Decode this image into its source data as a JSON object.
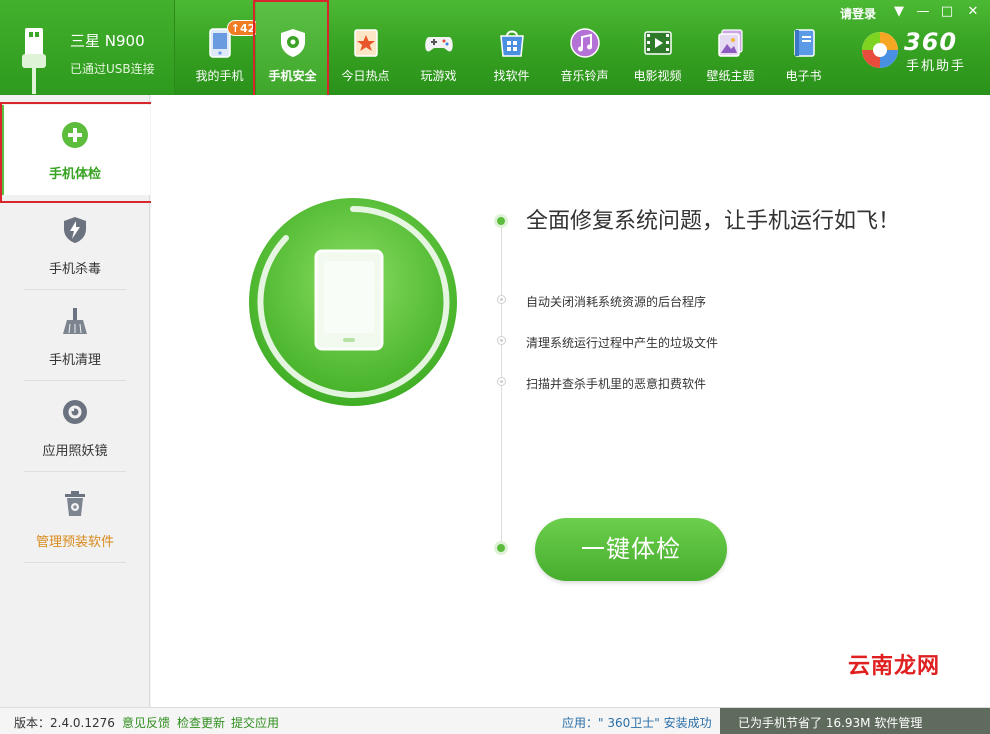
{
  "device": {
    "name": "三星 N900",
    "status": "已通过USB连接"
  },
  "nav": {
    "items": [
      {
        "label": "我的手机",
        "icon": "phone-icon",
        "badge": "↑42"
      },
      {
        "label": "手机安全",
        "icon": "shield-icon",
        "active": true
      },
      {
        "label": "今日热点",
        "icon": "news-star-icon"
      },
      {
        "label": "玩游戏",
        "icon": "gamepad-icon"
      },
      {
        "label": "找软件",
        "icon": "app-store-icon"
      },
      {
        "label": "音乐铃声",
        "icon": "music-icon"
      },
      {
        "label": "电影视频",
        "icon": "film-icon"
      },
      {
        "label": "壁纸主题",
        "icon": "wallpaper-icon"
      },
      {
        "label": "电子书",
        "icon": "ebook-icon"
      }
    ]
  },
  "titlebar": {
    "login": "请登录",
    "menu": "▼",
    "minimize": "—",
    "maximize": "□",
    "close": "✕"
  },
  "brand": {
    "name": "360",
    "sub": "手机助手"
  },
  "sidebar": {
    "items": [
      {
        "label": "手机体检",
        "icon": "plus-circle-icon",
        "active": true
      },
      {
        "label": "手机杀毒",
        "icon": "shield-bolt-icon"
      },
      {
        "label": "手机清理",
        "icon": "broom-icon"
      },
      {
        "label": "应用照妖镜",
        "icon": "lens-icon"
      },
      {
        "label": "管理预装软件",
        "icon": "trash-manage-icon",
        "warn": true
      }
    ]
  },
  "main": {
    "headline": "全面修复系统问题，让手机运行如飞！",
    "features": [
      "自动关闭消耗系统资源的后台程序",
      "清理系统运行过程中产生的垃圾文件",
      "扫描并查杀手机里的恶意扣费软件"
    ],
    "scan_button": "一键体检"
  },
  "statusbar": {
    "version": "版本：2.4.0.1276",
    "links": [
      "意见反馈",
      "检查更新",
      "提交应用"
    ],
    "install_msg": "应用：\" 360卫士\" 安装成功",
    "saved_msg": "已为手机节省了 16.93M    软件管理"
  },
  "watermark": "云南龙网",
  "colors": {
    "brand_green": "#35a021",
    "accent_green": "#5bbf3f",
    "highlight_red": "#d9262c"
  }
}
